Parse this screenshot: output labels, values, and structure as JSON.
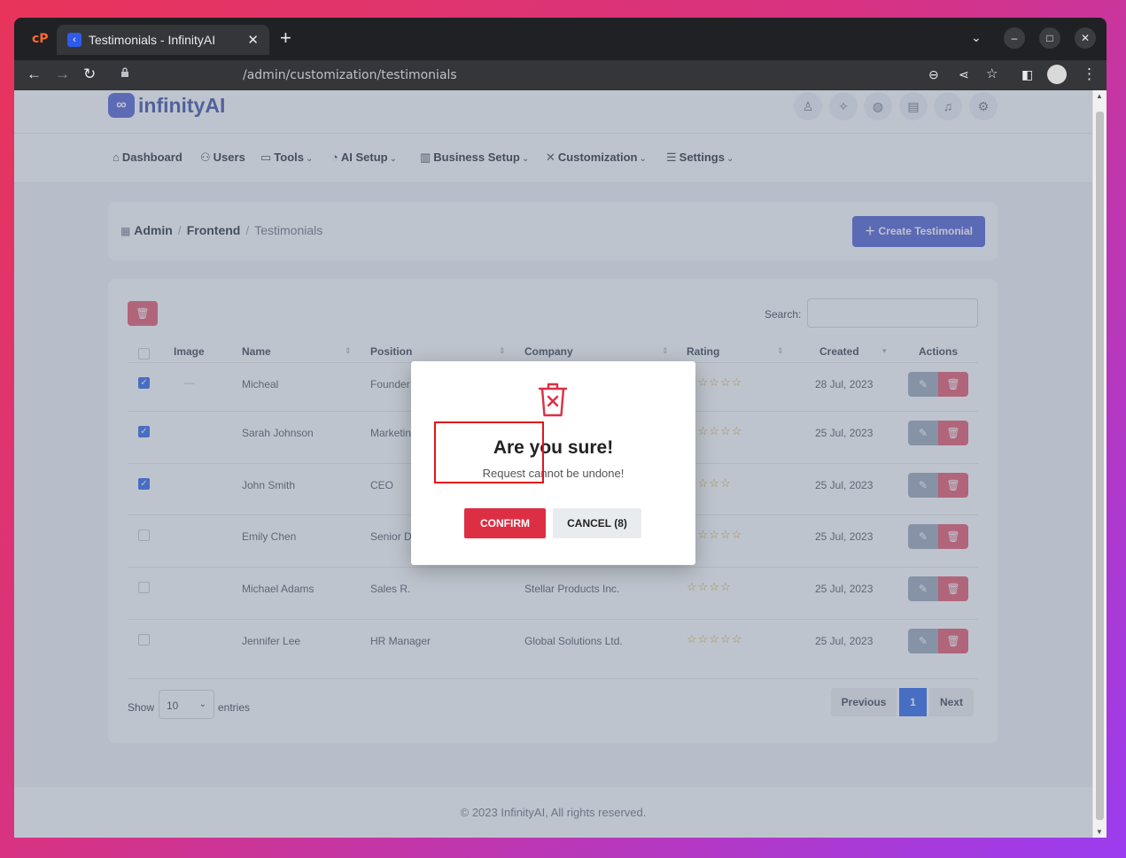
{
  "browser": {
    "tab_title": "Testimonials - InfinityAI",
    "url": "/admin/customization/testimonials",
    "cp_logo": "cP"
  },
  "app": {
    "logo_text": "infinityAI",
    "nav": [
      "Dashboard",
      "Users",
      "Tools",
      "AI Setup",
      "Business Setup",
      "Customization",
      "Settings"
    ]
  },
  "breadcrumb": {
    "admin": "Admin",
    "frontend": "Frontend",
    "current": "Testimonials",
    "create_button": "Create Testimonial"
  },
  "table": {
    "search_label": "Search:",
    "headers": [
      "Image",
      "Name",
      "Position",
      "Company",
      "Rating",
      "Created",
      "Actions"
    ],
    "rows": [
      {
        "name": "Micheal",
        "position": "Founder",
        "company": "",
        "rating": 5,
        "created": "28 Jul, 2023",
        "checked": true
      },
      {
        "name": "Sarah Johnson",
        "position": "Marketin",
        "company": "",
        "rating": 5,
        "created": "25 Jul, 2023",
        "checked": true
      },
      {
        "name": "John Smith",
        "position": "CEO",
        "company": "",
        "rating": 4,
        "created": "25 Jul, 2023",
        "checked": true
      },
      {
        "name": "Emily Chen",
        "position": "Senior D",
        "company": "",
        "rating": 5,
        "created": "25 Jul, 2023",
        "checked": false
      },
      {
        "name": "Michael Adams",
        "position": "Sales R.",
        "company": "Stellar Products Inc.",
        "rating": 4,
        "created": "25 Jul, 2023",
        "checked": false
      },
      {
        "name": "Jennifer Lee",
        "position": "HR Manager",
        "company": "Global Solutions Ltd.",
        "rating": 5,
        "created": "25 Jul, 2023",
        "checked": false
      }
    ],
    "show_label": "Show",
    "show_value": "10",
    "entries_label": "entries",
    "pagination": {
      "previous": "Previous",
      "page": "1",
      "next": "Next"
    }
  },
  "footer": "© 2023 InfinityAI, All rights reserved.",
  "modal": {
    "title": "Are you sure!",
    "text": "Request cannot be undone!",
    "confirm": "CONFIRM",
    "cancel": "CANCEL (8)"
  },
  "colors": {
    "accent": "#4c5bd4",
    "danger": "#dc2f44",
    "highlight": "#e3141a"
  }
}
